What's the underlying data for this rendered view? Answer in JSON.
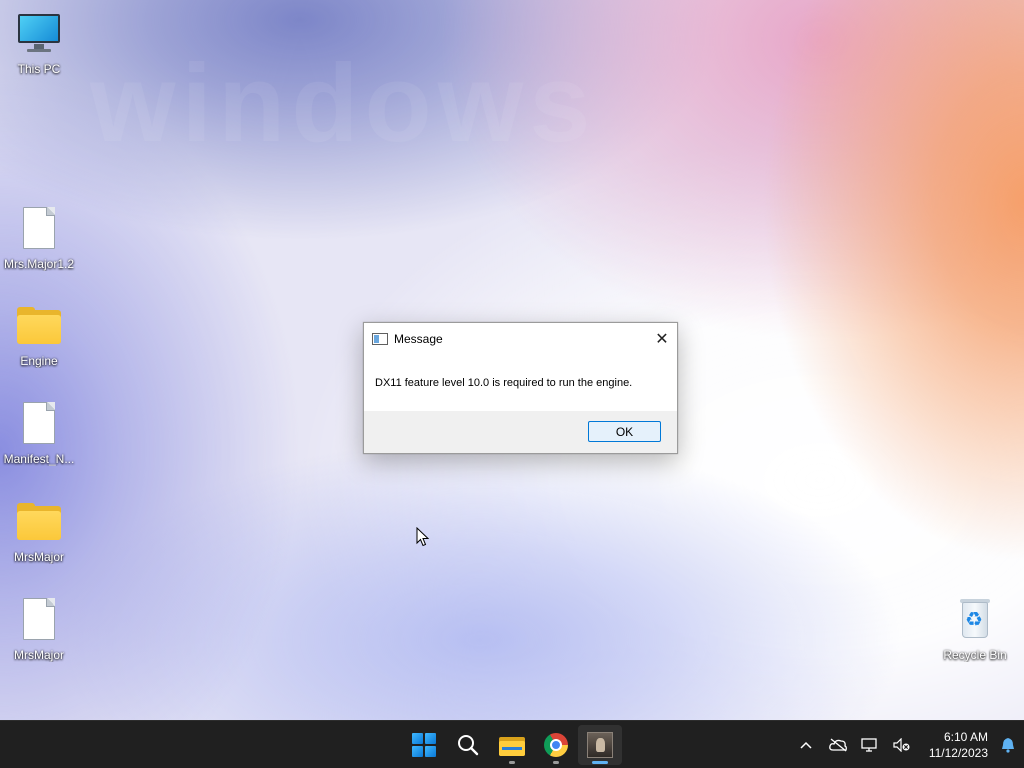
{
  "desktop": {
    "icons": [
      {
        "label": "This PC"
      },
      {
        "label": "Mrs.Major1.2"
      },
      {
        "label": "Engine"
      },
      {
        "label": "Manifest_N..."
      },
      {
        "label": "MrsMajor"
      },
      {
        "label": "MrsMajor"
      },
      {
        "label": "Recycle Bin"
      }
    ]
  },
  "dialog": {
    "title": "Message",
    "message": "DX11 feature level 10.0 is required to run the engine.",
    "ok_label": "OK",
    "close_glyph": "✕"
  },
  "taskbar": {
    "apps": [
      {
        "name": "start-icon"
      },
      {
        "name": "search-icon"
      },
      {
        "name": "file-explorer-icon"
      },
      {
        "name": "chrome-icon"
      },
      {
        "name": "game-app-icon"
      }
    ],
    "tray": {
      "chevron": "^",
      "time": "6:10 AM",
      "date": "11/12/2023"
    }
  },
  "colors": {
    "accent": "#0078d7",
    "taskbar_bg": "#202020",
    "folder": "#ffcd3c"
  }
}
